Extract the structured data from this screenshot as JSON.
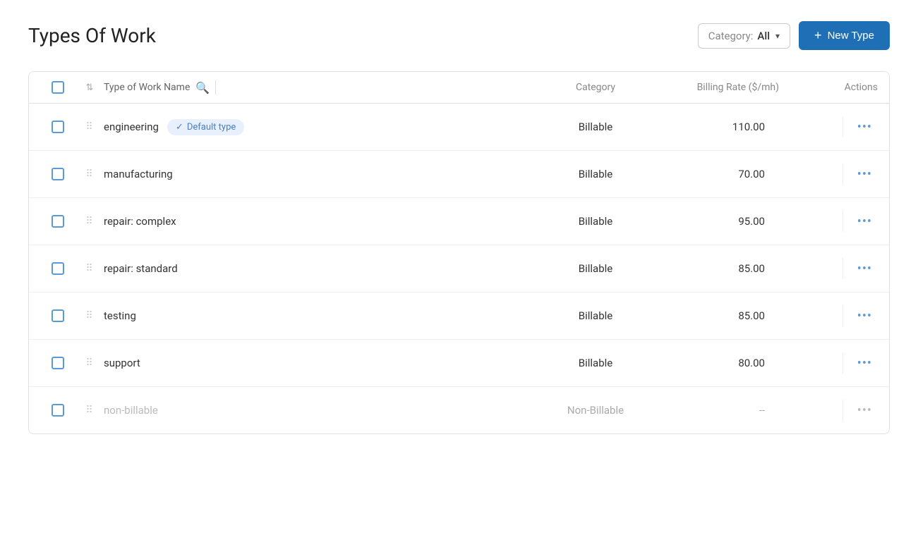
{
  "header": {
    "title": "Types Of Work",
    "category_filter_label": "Category:",
    "category_filter_value": "All",
    "new_type_button_label": "New Type"
  },
  "table": {
    "columns": {
      "name": "Type of Work Name",
      "category": "Category",
      "billing_rate": "Billing Rate ($/mh)",
      "actions": "Actions"
    },
    "rows": [
      {
        "id": 1,
        "name": "engineering",
        "is_default": true,
        "default_label": "Default type",
        "category": "Billable",
        "billing_rate": "110.00",
        "dimmed": false
      },
      {
        "id": 2,
        "name": "manufacturing",
        "is_default": false,
        "default_label": "",
        "category": "Billable",
        "billing_rate": "70.00",
        "dimmed": false
      },
      {
        "id": 3,
        "name": "repair: complex",
        "is_default": false,
        "default_label": "",
        "category": "Billable",
        "billing_rate": "95.00",
        "dimmed": false
      },
      {
        "id": 4,
        "name": "repair: standard",
        "is_default": false,
        "default_label": "",
        "category": "Billable",
        "billing_rate": "85.00",
        "dimmed": false
      },
      {
        "id": 5,
        "name": "testing",
        "is_default": false,
        "default_label": "",
        "category": "Billable",
        "billing_rate": "85.00",
        "dimmed": false
      },
      {
        "id": 6,
        "name": "support",
        "is_default": false,
        "default_label": "",
        "category": "Billable",
        "billing_rate": "80.00",
        "dimmed": false
      },
      {
        "id": 7,
        "name": "non-billable",
        "is_default": false,
        "default_label": "",
        "category": "Non-Billable",
        "billing_rate": "--",
        "dimmed": true
      }
    ]
  }
}
